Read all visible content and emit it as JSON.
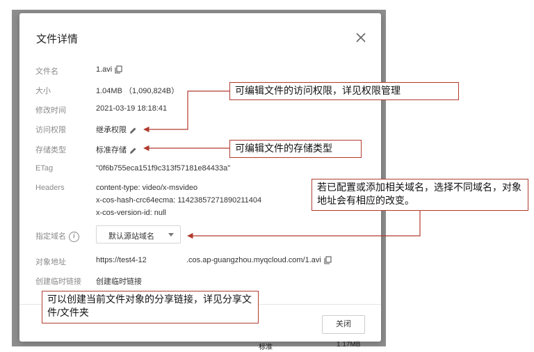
{
  "backdrop": {
    "bottom_left": "标准",
    "bottom_right": "1.17MB"
  },
  "dialog": {
    "title": "文件详情",
    "rows": {
      "name": {
        "label": "文件名",
        "value": "1.avi"
      },
      "size": {
        "label": "大小",
        "value": "1.04MB  （1,090,824B）"
      },
      "mtime": {
        "label": "修改时间",
        "value": "2021-03-19 18:18:41"
      },
      "acl": {
        "label": "访问权限",
        "value": "继承权限"
      },
      "storage": {
        "label": "存储类型",
        "value": "标准存储"
      },
      "etag": {
        "label": "ETag",
        "value": "\"0f6b755eca151f9c313f57181e84433a\""
      },
      "headers": {
        "label": "Headers",
        "lines": [
          "content-type: video/x-msvideo",
          "x-cos-hash-crc64ecma: 11423857271890211404",
          "x-cos-version-id: null"
        ]
      },
      "domain": {
        "label": "指定域名",
        "selected": "默认源站域名"
      },
      "url": {
        "label": "对象地址",
        "part1": "https://test4-12",
        "part2": ".cos.ap-guangzhou.myqcloud.com/1.avi"
      },
      "temp_link": {
        "label": "创建临时链接",
        "link_text": "创建临时链接"
      }
    },
    "close_button": "关闭"
  },
  "callouts": {
    "acl": "可编辑文件的访问权限，详见权限管理",
    "storage": "可编辑文件的存储类型",
    "domain": "若已配置或添加相关域名，选择不同域名，对象地址会有相应的改变。",
    "share": "可以创建当前文件对象的分享链接，详见分享文件/文件夹"
  },
  "colors": {
    "callout_border": "#b03a2e",
    "link": "#1a6ee6",
    "backdrop": "#8e8e8e"
  },
  "icons": {
    "copy": "copy-icon",
    "edit": "pencil-icon",
    "help": "info-icon",
    "close": "close-icon"
  }
}
